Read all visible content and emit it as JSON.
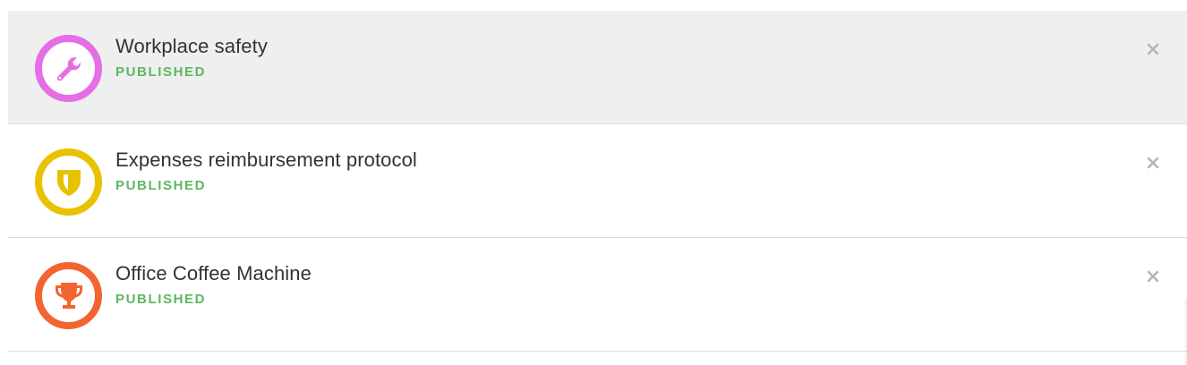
{
  "items": [
    {
      "title": "Workplace safety",
      "status": "PUBLISHED",
      "icon": "wrench-icon",
      "color": "#e56ee5",
      "selected": true
    },
    {
      "title": "Expenses reimbursement protocol",
      "status": "PUBLISHED",
      "icon": "shield-icon",
      "color": "#e8c200",
      "selected": false
    },
    {
      "title": "Office Coffee Machine",
      "status": "PUBLISHED",
      "icon": "trophy-icon",
      "color": "#f26531",
      "selected": false
    }
  ],
  "colors": {
    "status_green": "#5cb85c",
    "close_gray": "#b5b5b5",
    "selected_bg": "#efefef"
  }
}
